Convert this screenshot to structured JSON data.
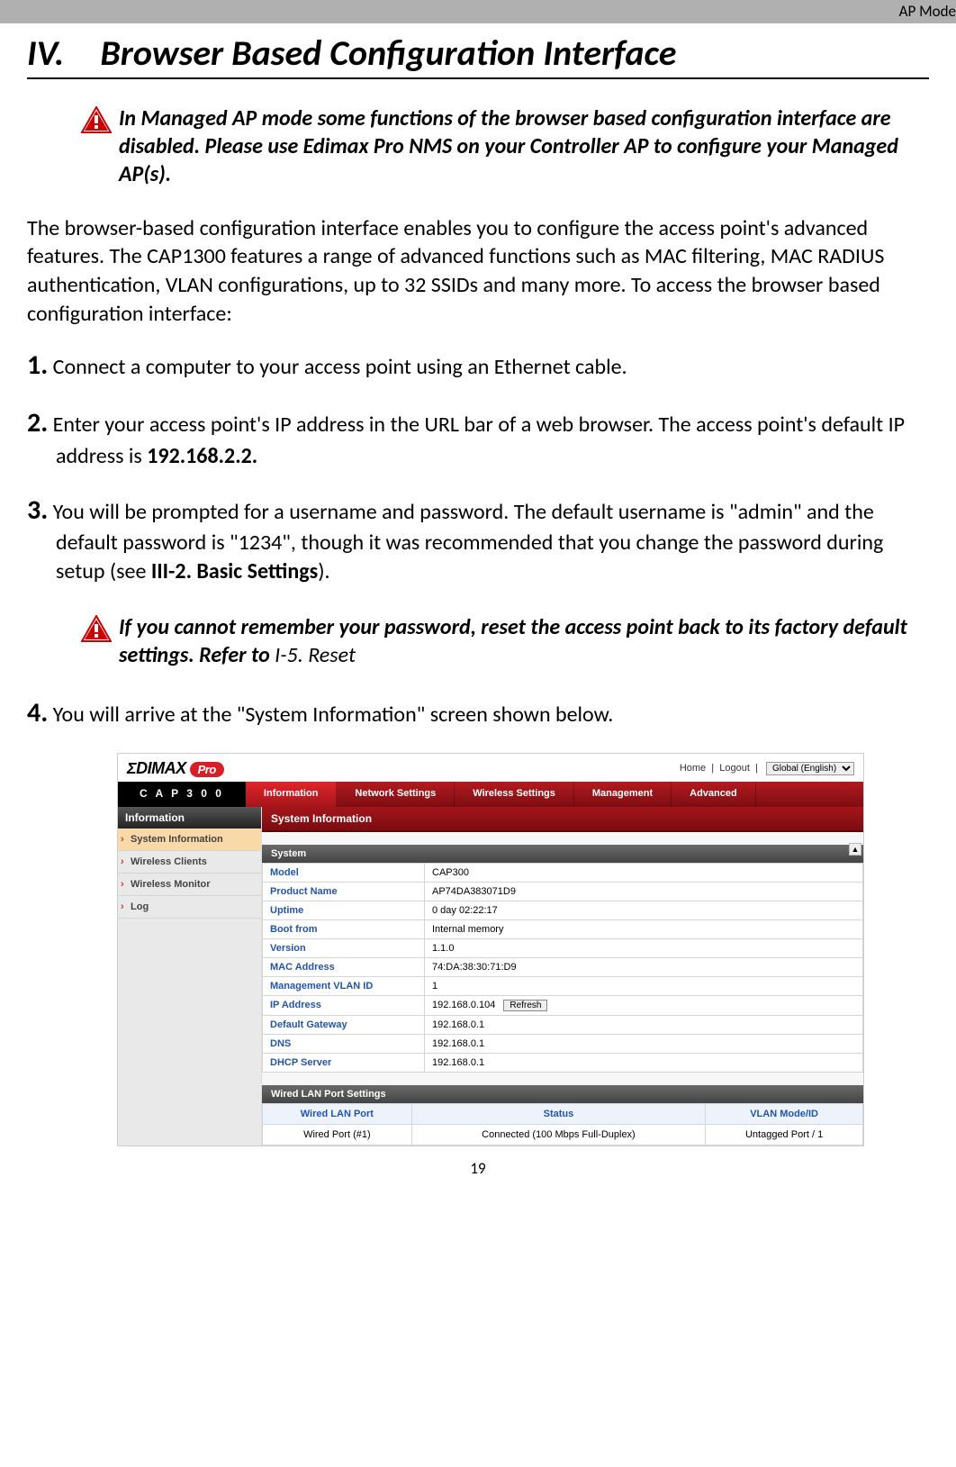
{
  "header_mode": "AP Mode",
  "title": "IV. Browser Based Configuration Interface",
  "note1": "In Managed AP mode some functions of the browser based configuration interface are disabled. Please use Edimax Pro NMS on your Controller AP to configure your Managed AP(s).",
  "intro": "The browser-based configuration interface enables you to configure the access point's advanced features. The CAP1300 features a range of advanced functions such as MAC filtering, MAC RADIUS authentication, VLAN configurations, up to 32 SSIDs and many more. To access the browser based configuration interface:",
  "steps": {
    "s1_num": "1.",
    "s1": " Connect a computer to your access point using an Ethernet cable.",
    "s2_num": "2.",
    "s2a": " Enter your access point's IP address in the URL bar of a web browser. The access point's default IP address is ",
    "s2b": "192.168.2.2.",
    "s3_num": "3.",
    "s3a": " You will be prompted for a username and password. The default username is \"admin\" and the default password is \"1234\", though it was recommended that you change the password during setup (see ",
    "s3b": "III-2. Basic Settings",
    "s3c": ").",
    "s4_num": "4.",
    "s4": " You will arrive at the \"System Information\" screen shown below."
  },
  "note2a": "If you cannot remember your password, reset the access point back to its factory default settings. Refer to ",
  "note2b": "I-5. Reset",
  "webui": {
    "brand_pre": "ΣDIMAX",
    "brand_badge": "Pro",
    "toplinks_home": "Home",
    "toplinks_logout": "Logout",
    "lang_select": "Global (English)",
    "model": "C A P 3 0 0",
    "nav": [
      "Information",
      "Network Settings",
      "Wireless Settings",
      "Management",
      "Advanced"
    ],
    "side_heading": "Information",
    "side_items": [
      "System Information",
      "Wireless Clients",
      "Wireless Monitor",
      "Log"
    ],
    "panel_title": "System Information",
    "system_title": "System",
    "rows": [
      {
        "k": "Model",
        "v": "CAP300"
      },
      {
        "k": "Product Name",
        "v": "AP74DA383071D9"
      },
      {
        "k": "Uptime",
        "v": "0 day 02:22:17"
      },
      {
        "k": "Boot from",
        "v": "Internal memory"
      },
      {
        "k": "Version",
        "v": "1.1.0"
      },
      {
        "k": "MAC Address",
        "v": "74:DA:38:30:71:D9"
      },
      {
        "k": "Management VLAN ID",
        "v": "1"
      },
      {
        "k": "IP Address",
        "v": "192.168.0.104"
      },
      {
        "k": "Default Gateway",
        "v": "192.168.0.1"
      },
      {
        "k": "DNS",
        "v": "192.168.0.1"
      },
      {
        "k": "DHCP Server",
        "v": "192.168.0.1"
      }
    ],
    "refresh": "Refresh",
    "wired_title": "Wired LAN Port Settings",
    "wired_headers": [
      "Wired LAN Port",
      "Status",
      "VLAN Mode/ID"
    ],
    "wired_row": [
      "Wired Port (#1)",
      "Connected (100 Mbps Full-Duplex)",
      "Untagged Port  /   1"
    ]
  },
  "page_number": "19"
}
